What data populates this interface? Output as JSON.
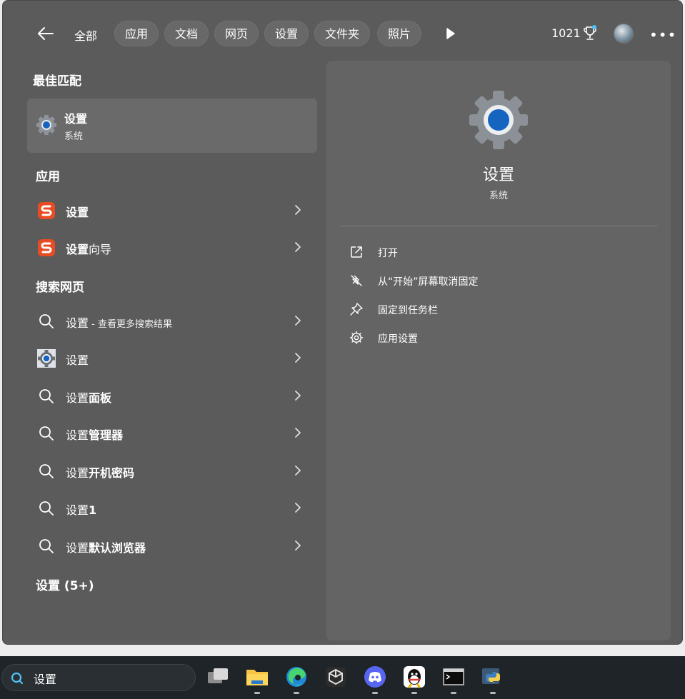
{
  "topbar": {
    "all_label": "全部",
    "chips": [
      "应用",
      "文档",
      "网页",
      "设置",
      "文件夹",
      "照片"
    ],
    "score": "1021"
  },
  "best_match": {
    "heading": "最佳匹配",
    "title": "设置",
    "subtitle": "系统"
  },
  "apps": {
    "heading": "应用",
    "items": [
      {
        "bold": "设置",
        "rest": ""
      },
      {
        "bold": "设置",
        "rest": "向导"
      }
    ]
  },
  "web": {
    "heading": "搜索网页",
    "items": [
      {
        "plain": "设置",
        "bold": "",
        "suffix": " - 查看更多搜索结果"
      },
      {
        "plain": "设置",
        "bold": "",
        "suffix": ""
      },
      {
        "plain": "设置",
        "bold": "面板",
        "suffix": ""
      },
      {
        "plain": "设置",
        "bold": "管理器",
        "suffix": ""
      },
      {
        "plain": "设置",
        "bold": "开机密码",
        "suffix": ""
      },
      {
        "plain": "设置",
        "bold": "1",
        "suffix": ""
      },
      {
        "plain": "设置",
        "bold": "默认浏览器",
        "suffix": ""
      }
    ]
  },
  "settings_more": "设置 (5+)",
  "detail": {
    "title": "设置",
    "subtitle": "系统",
    "actions": [
      "打开",
      "从“开始”屏幕取消固定",
      "固定到任务栏",
      "应用设置"
    ]
  },
  "taskbar": {
    "search_value": "设置"
  },
  "colors": {
    "panel_bg": "#5b5b5b",
    "detail_bg": "#646464",
    "accent_blue": "#1565c0",
    "sogou_red": "#e84c22",
    "taskbar_bg": "#1f2428"
  }
}
